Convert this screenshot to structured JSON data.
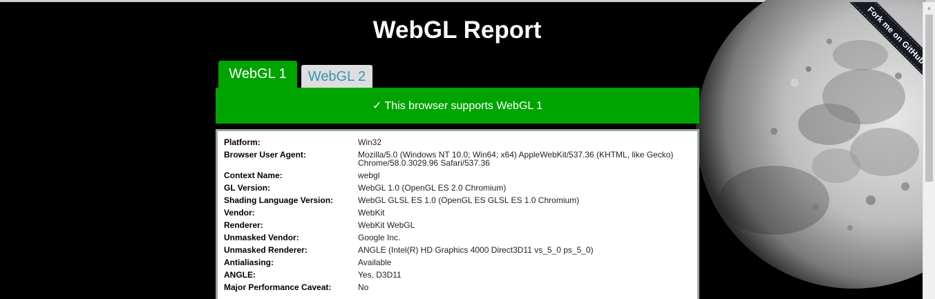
{
  "page": {
    "title": "WebGL Report"
  },
  "ribbon": {
    "label": "Fork me on GitHub"
  },
  "tabs": [
    {
      "label": "WebGL 1",
      "active": true
    },
    {
      "label": "WebGL 2",
      "active": false
    }
  ],
  "banner": {
    "text": "✓ This browser supports WebGL 1"
  },
  "report": {
    "rows": [
      {
        "label": "Platform:",
        "value": "Win32"
      },
      {
        "label": "Browser User Agent:",
        "value": "Mozilla/5.0 (Windows NT 10.0; Win64; x64) AppleWebKit/537.36 (KHTML, like Gecko) Chrome/58.0.3029.96 Safari/537.36"
      },
      {
        "label": "Context Name:",
        "value": "webgl"
      },
      {
        "label": "GL Version:",
        "value": "WebGL 1.0 (OpenGL ES 2.0 Chromium)"
      },
      {
        "label": "Shading Language Version:",
        "value": "WebGL GLSL ES 1.0 (OpenGL ES GLSL ES 1.0 Chromium)"
      },
      {
        "label": "Vendor:",
        "value": "WebKit"
      },
      {
        "label": "Renderer:",
        "value": "WebKit WebGL"
      },
      {
        "label": "Unmasked Vendor:",
        "value": "Google Inc."
      },
      {
        "label": "Unmasked Renderer:",
        "value": "ANGLE (Intel(R) HD Graphics 4000 Direct3D11 vs_5_0 ps_5_0)"
      },
      {
        "label": "Antialiasing:",
        "value": "Available"
      },
      {
        "label": "ANGLE:",
        "value": "Yes, D3D11"
      },
      {
        "label": "Major Performance Caveat:",
        "value": "No"
      }
    ]
  },
  "colors": {
    "accent_green": "#00a400",
    "inactive_tab_bg": "#dedede",
    "inactive_tab_text": "#3a91b0",
    "background": "#000000"
  },
  "icons": {
    "scroll_up": "triangle-up-icon",
    "background_image": "moon-image"
  }
}
